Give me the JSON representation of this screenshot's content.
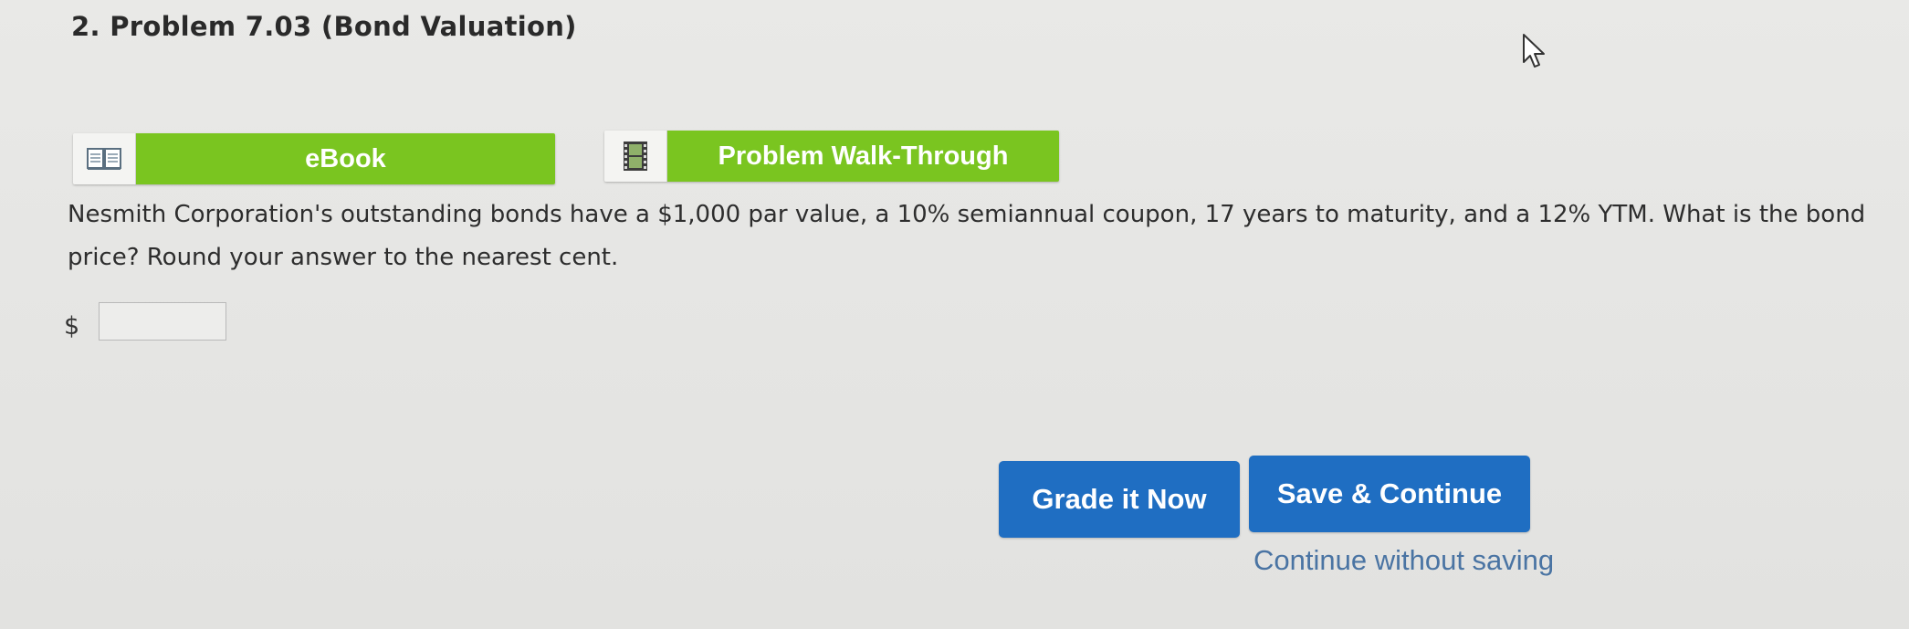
{
  "problem": {
    "title": "2. Problem 7.03 (Bond Valuation)"
  },
  "resources": {
    "ebook": {
      "label": "eBook",
      "icon": "book-icon"
    },
    "walkthrough": {
      "label": "Problem Walk-Through",
      "icon": "film-icon"
    }
  },
  "question": {
    "line1": "Nesmith Corporation's outstanding bonds have a $1,000 par value, a 10% semiannual coupon, 17 years to maturity, and a 12% YTM. What is the bond",
    "line2": "price? Round your answer to the nearest cent."
  },
  "answer": {
    "currency_symbol": "$",
    "value": ""
  },
  "actions": {
    "grade_label": "Grade it Now",
    "save_label": "Save & Continue",
    "continue_label": "Continue without saving"
  },
  "colors": {
    "resource_green": "#7ac520",
    "action_blue": "#1f6ec2",
    "link_blue": "#4a74a3"
  }
}
